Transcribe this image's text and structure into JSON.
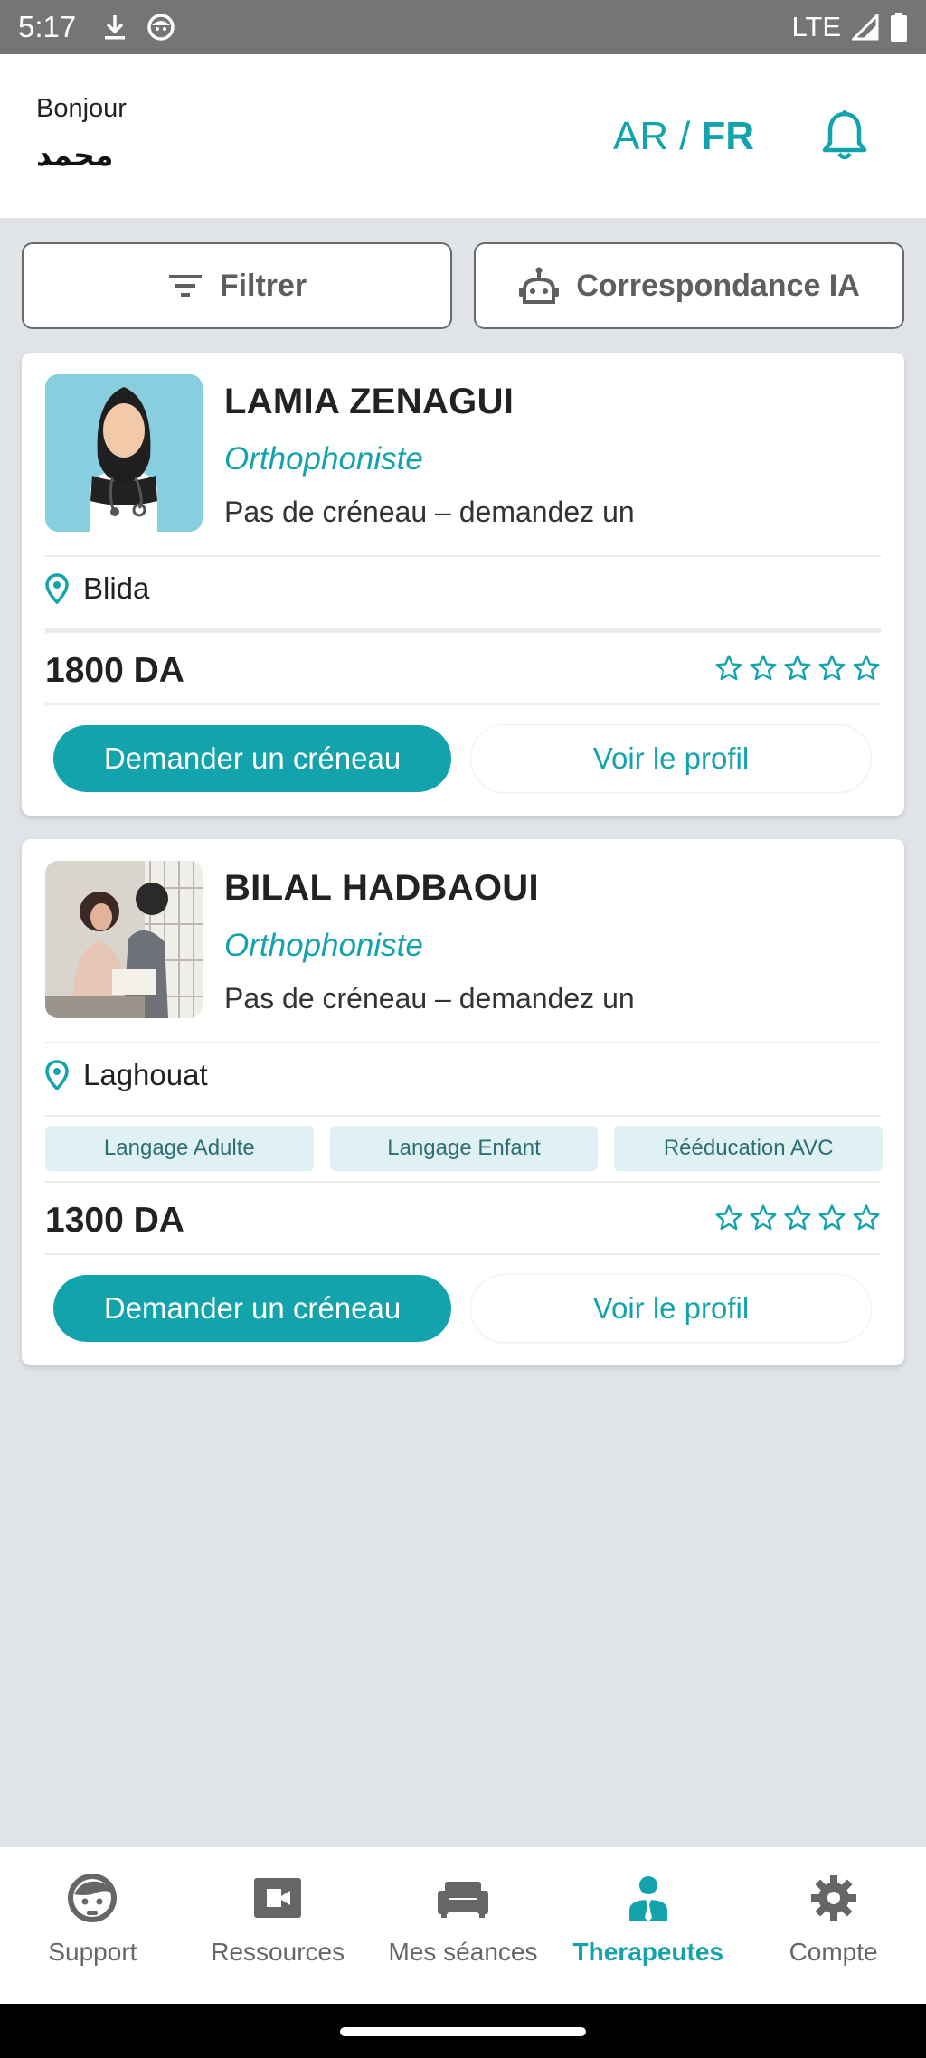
{
  "status_bar": {
    "time": "5:17",
    "network": "LTE",
    "icons": [
      "download-icon",
      "android-face-icon",
      "signal-icon",
      "battery-icon"
    ]
  },
  "header": {
    "greeting": "Bonjour",
    "username": "محمد",
    "lang_ar": "AR",
    "lang_sep": "/",
    "lang_fr": "FR",
    "bell_icon": "bell-icon"
  },
  "actions": {
    "filter_label": "Filtrer",
    "ai_label": "Correspondance IA"
  },
  "therapists": [
    {
      "name": "LAMIA ZENAGUI",
      "specialty": "Orthophoniste",
      "availability": "Pas de créneau – demandez un",
      "location": "Blida",
      "tags": [],
      "price": "1800 DA",
      "rating": 0,
      "request_label": "Demander un créneau",
      "profile_label": "Voir le profil"
    },
    {
      "name": "BILAL HADBAOUI",
      "specialty": "Orthophoniste",
      "availability": "Pas de créneau – demandez un",
      "location": "Laghouat",
      "tags": [
        "Langage Adulte",
        "Langage Enfant",
        "Rééducation AVC"
      ],
      "price": "1300 DA",
      "rating": 0,
      "request_label": "Demander un créneau",
      "profile_label": "Voir le profil"
    }
  ],
  "bottom_nav": [
    {
      "label": "Support",
      "icon": "support-face-icon",
      "active": false
    },
    {
      "label": "Ressources",
      "icon": "video-camera-icon",
      "active": false
    },
    {
      "label": "Mes séances",
      "icon": "sofa-icon",
      "active": false
    },
    {
      "label": "Therapeutes",
      "icon": "therapist-icon",
      "active": true
    },
    {
      "label": "Compte",
      "icon": "gear-icon",
      "active": false
    }
  ],
  "colors": {
    "accent": "#13a3ad",
    "background": "#e0e3e7",
    "tag_bg": "#dff1f2"
  }
}
